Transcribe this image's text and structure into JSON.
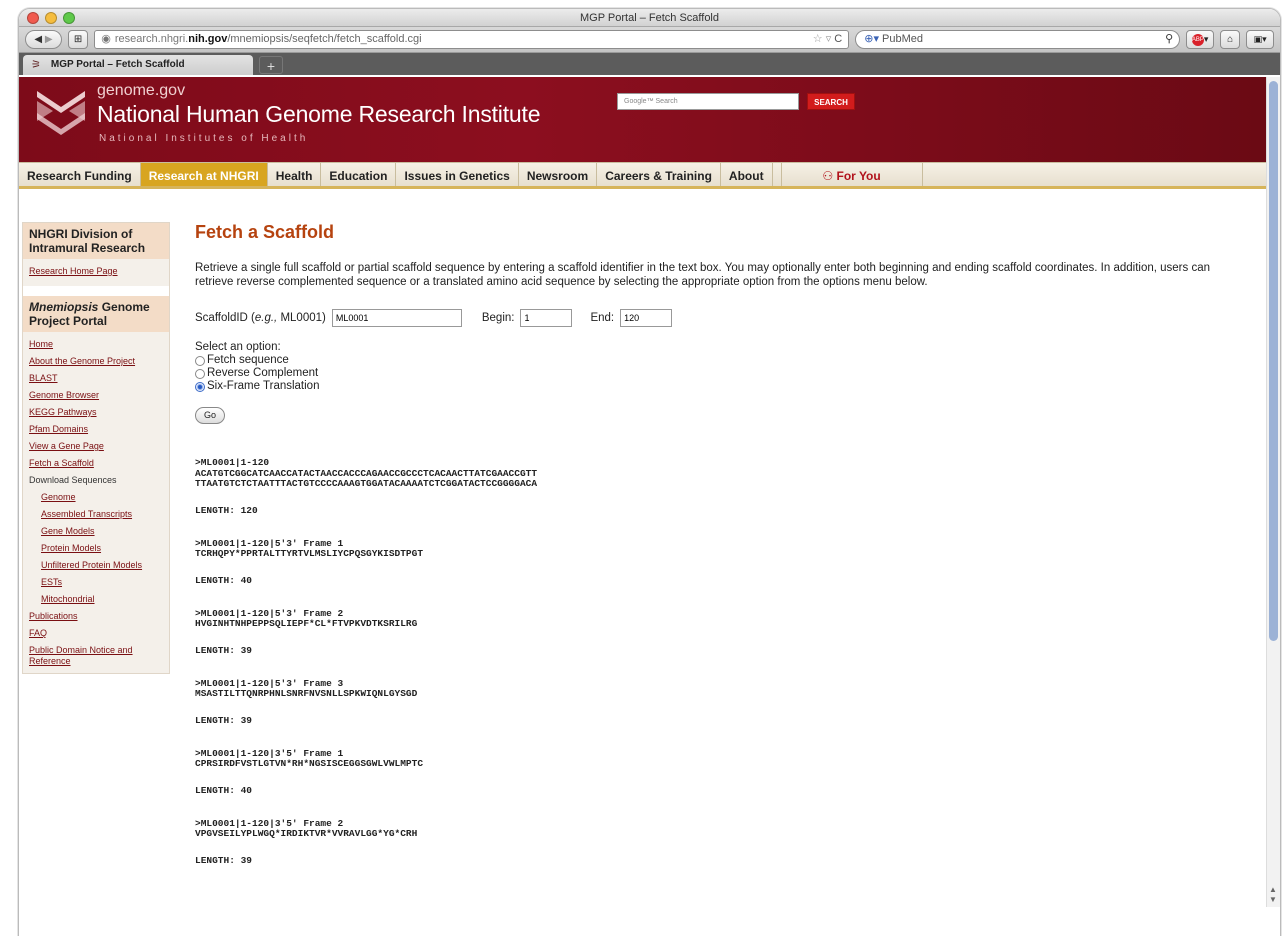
{
  "window": {
    "title": "MGP Portal – Fetch Scaffold"
  },
  "toolbar": {
    "url_domain_prefix": "research.nhgri.",
    "url_domain_bold": "nih.gov",
    "url_path": "/mnemiopsis/seqfetch/fetch_scaffold.cgi",
    "search_engine": "PubMed"
  },
  "tabs": [
    {
      "label": "MGP Portal – Fetch Scaffold"
    }
  ],
  "header": {
    "site": "genome.gov",
    "institute": "National Human Genome Research Institute",
    "nih": "National Institutes of Health",
    "search_placeholder": "Google™ Search",
    "search_button": "SEARCH"
  },
  "nav": {
    "items": [
      "Research Funding",
      "Research at NHGRI",
      "Health",
      "Education",
      "Issues in Genetics",
      "Newsroom",
      "Careers & Training",
      "About"
    ],
    "for_you": "For You",
    "active_index": 1
  },
  "sidebar": {
    "section1_title": "NHGRI Division of Intramural Research",
    "section1_links": [
      "Research Home Page"
    ],
    "section2_title_italic": "Mnemiopsis",
    "section2_title_rest": " Genome Project Portal",
    "links": [
      {
        "label": "Home",
        "sub": false,
        "link": true
      },
      {
        "label": "About the Genome Project",
        "sub": false,
        "link": true
      },
      {
        "label": "BLAST",
        "sub": false,
        "link": true
      },
      {
        "label": "Genome Browser",
        "sub": false,
        "link": true
      },
      {
        "label": "KEGG Pathways",
        "sub": false,
        "link": true
      },
      {
        "label": "Pfam Domains",
        "sub": false,
        "link": true
      },
      {
        "label": "View a Gene Page",
        "sub": false,
        "link": true
      },
      {
        "label": "Fetch a Scaffold",
        "sub": false,
        "link": true
      },
      {
        "label": "Download Sequences",
        "sub": false,
        "link": false
      },
      {
        "label": "Genome",
        "sub": true,
        "link": true
      },
      {
        "label": "Assembled Transcripts",
        "sub": true,
        "link": true
      },
      {
        "label": "Gene Models",
        "sub": true,
        "link": true
      },
      {
        "label": "Protein Models",
        "sub": true,
        "link": true
      },
      {
        "label": "Unfiltered Protein Models",
        "sub": true,
        "link": true
      },
      {
        "label": "ESTs",
        "sub": true,
        "link": true
      },
      {
        "label": "Mitochondrial",
        "sub": true,
        "link": true
      },
      {
        "label": "Publications",
        "sub": false,
        "link": true
      },
      {
        "label": "FAQ",
        "sub": false,
        "link": true
      },
      {
        "label": "Public Domain Notice and Reference",
        "sub": false,
        "link": true
      }
    ]
  },
  "main": {
    "title": "Fetch a Scaffold",
    "intro": "Retrieve a single full scaffold or partial scaffold sequence by entering a scaffold identifier in the text box. You may optionally enter both beginning and ending scaffold coordinates. In addition, users can retrieve reverse complemented sequence or a translated amino acid sequence by selecting the appropriate option from the options menu below.",
    "scaffold_label_prefix": "ScaffoldID (",
    "scaffold_label_eg": "e.g.,",
    "scaffold_label_suffix": " ML0001)",
    "scaffold_value": "ML0001",
    "begin_label": "Begin:",
    "begin_value": "1",
    "end_label": "End:",
    "end_value": "120",
    "options_label": "Select an option:",
    "options": [
      {
        "label": "Fetch sequence",
        "selected": false
      },
      {
        "label": "Reverse Complement",
        "selected": false
      },
      {
        "label": "Six-Frame Translation",
        "selected": true
      }
    ],
    "go_label": "Go"
  },
  "results": [
    {
      "header": ">ML0001|1-120",
      "lines": [
        "ACATGTCGGCATCAACCATACTAACCACCCAGAACCGCCCTCACAACTTATCGAACCGTT",
        "TTAATGTCTCTAATTTACTGTCCCCAAAGTGGATACAAAATCTCGGATACTCCGGGGACA"
      ],
      "length": "LENGTH: 120"
    },
    {
      "header": ">ML0001|1-120|5'3' Frame 1",
      "lines": [
        "TCRHQPY*PPRTALTTYRTVLMSLIYCPQSGYKISDTPGT"
      ],
      "length": "LENGTH: 40"
    },
    {
      "header": ">ML0001|1-120|5'3' Frame 2",
      "lines": [
        "HVGINHTNHPEPPSQLIEPF*CL*FTVPKVDTKSRILRG"
      ],
      "length": "LENGTH: 39"
    },
    {
      "header": ">ML0001|1-120|5'3' Frame 3",
      "lines": [
        "MSASTILTTQNRPHNLSNRFNVSNLLSPKWIQNLGYSGD"
      ],
      "length": "LENGTH: 39"
    },
    {
      "header": ">ML0001|1-120|3'5' Frame 1",
      "lines": [
        "CPRSIRDFVSTLGTVN*RH*NGSISCEGGSGWLVWLMPTC"
      ],
      "length": "LENGTH: 40"
    },
    {
      "header": ">ML0001|1-120|3'5' Frame 2",
      "lines": [
        "VPGVSEILYPLWGQ*IRDIKTVR*VVRAVLGG*YG*CRH"
      ],
      "length": "LENGTH: 39"
    }
  ]
}
